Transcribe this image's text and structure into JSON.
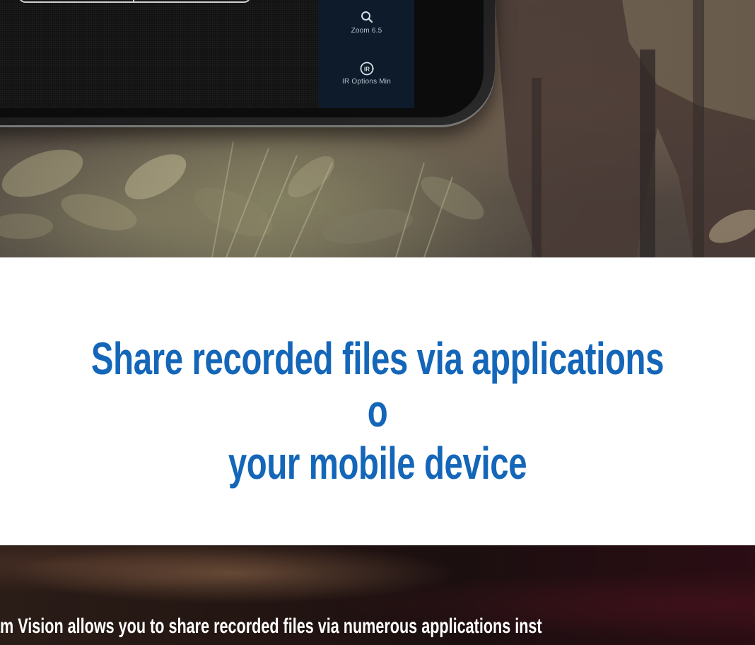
{
  "hero": {
    "controls": [
      {
        "icon": "search-icon",
        "label": "Zoom 6.5"
      },
      {
        "icon": "ir-icon",
        "label": "IR Options Min"
      }
    ]
  },
  "headline": {
    "line1": "Share recorded files via applications o",
    "line2": "your mobile device"
  },
  "bottom": {
    "description": "am Vision allows you to share recorded files via numerous applications inst"
  },
  "colors": {
    "headline": "#1466b8",
    "panel": "#0d1b2a"
  }
}
